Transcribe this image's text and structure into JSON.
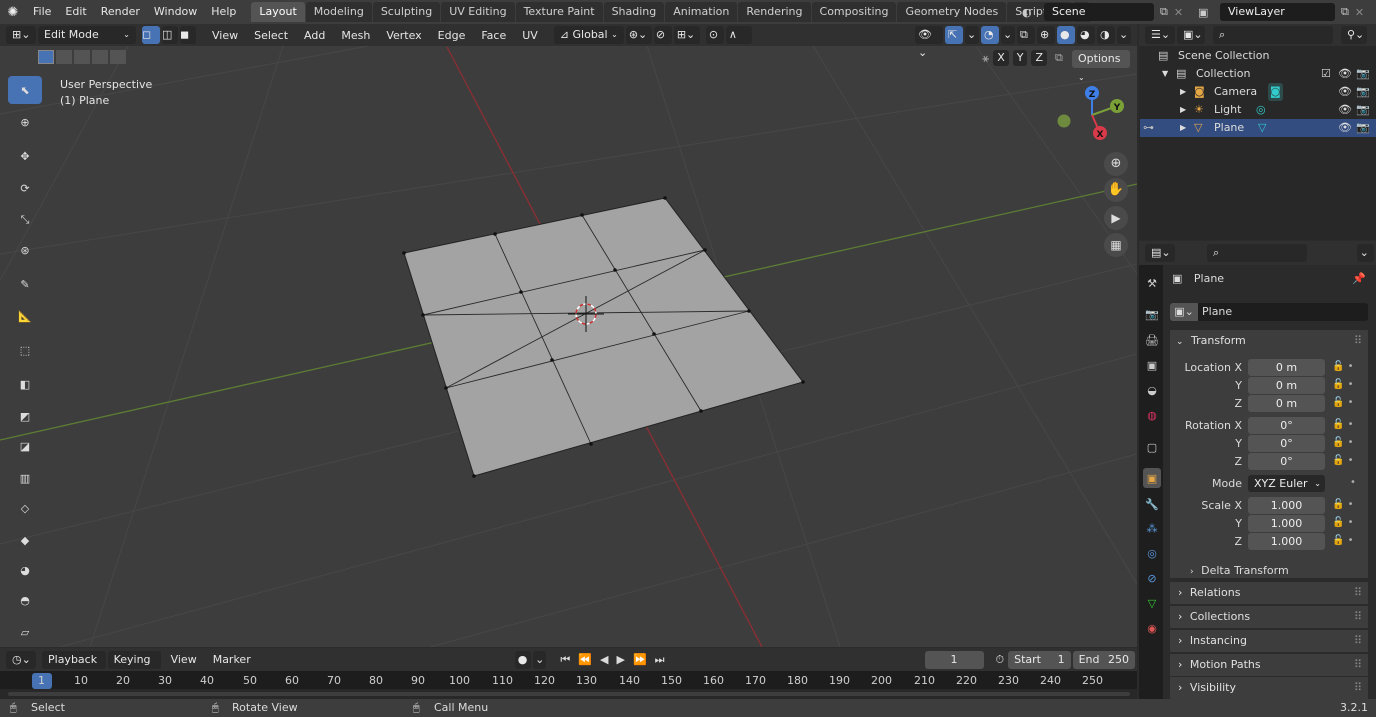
{
  "app": {
    "version": "3.2.1"
  },
  "menubar": {
    "items": [
      "File",
      "Edit",
      "Render",
      "Window",
      "Help"
    ]
  },
  "workspaces": [
    "Layout",
    "Modeling",
    "Sculpting",
    "UV Editing",
    "Texture Paint",
    "Shading",
    "Animation",
    "Rendering",
    "Compositing",
    "Geometry Nodes",
    "Scripting"
  ],
  "active_workspace": "Layout",
  "scene": {
    "name": "Scene",
    "view_layer": "ViewLayer"
  },
  "viewport_header": {
    "mode": "Edit Mode",
    "menus": [
      "View",
      "Select",
      "Add",
      "Mesh",
      "Vertex",
      "Edge",
      "Face",
      "UV"
    ],
    "orientation": "Global"
  },
  "viewport": {
    "perspective_label": "User Perspective",
    "object_label": "(1) Plane",
    "axis_buttons": [
      "X",
      "Y",
      "Z"
    ],
    "options_label": "Options",
    "gizmo_labels": {
      "z": "Z",
      "y": "Y",
      "x": "X"
    }
  },
  "outliner": {
    "root": "Scene Collection",
    "collection": "Collection",
    "objects": [
      {
        "name": "Camera",
        "color": "#e5a646"
      },
      {
        "name": "Light",
        "color": "#e5a646"
      },
      {
        "name": "Plane",
        "color": "#e5a646",
        "selected": true
      }
    ]
  },
  "properties": {
    "object_name": "Plane",
    "datablock_name": "Plane",
    "transform_label": "Transform",
    "location": {
      "label_x": "Location X",
      "x": "0 m",
      "y": "0 m",
      "z": "0 m"
    },
    "rotation": {
      "label_x": "Rotation X",
      "x": "0°",
      "y": "0°",
      "z": "0°"
    },
    "mode_label": "Mode",
    "mode_value": "XYZ Euler",
    "scale": {
      "label_x": "Scale X",
      "x": "1.000",
      "y": "1.000",
      "z": "1.000"
    },
    "axis_y": "Y",
    "axis_z": "Z",
    "delta_transform": "Delta Transform",
    "panels": [
      "Relations",
      "Collections",
      "Instancing",
      "Motion Paths",
      "Visibility"
    ]
  },
  "timeline": {
    "menus": [
      "Playback",
      "Keying",
      "View",
      "Marker"
    ],
    "current_frame": "1",
    "start_label": "Start",
    "start": "1",
    "end_label": "End",
    "end": "250",
    "ticks": [
      "1",
      "10",
      "20",
      "30",
      "40",
      "50",
      "60",
      "70",
      "80",
      "90",
      "100",
      "110",
      "120",
      "130",
      "140",
      "150",
      "160",
      "170",
      "180",
      "190",
      "200",
      "210",
      "220",
      "230",
      "240",
      "250"
    ]
  },
  "statusbar": {
    "select": "Select",
    "rotate": "Rotate View",
    "call_menu": "Call Menu"
  },
  "colors": {
    "accent": "#4772b3",
    "x_axis": "#d83a4a",
    "y_axis": "#7aa037",
    "z_axis": "#3e7fe8",
    "object": "#e5a646"
  }
}
